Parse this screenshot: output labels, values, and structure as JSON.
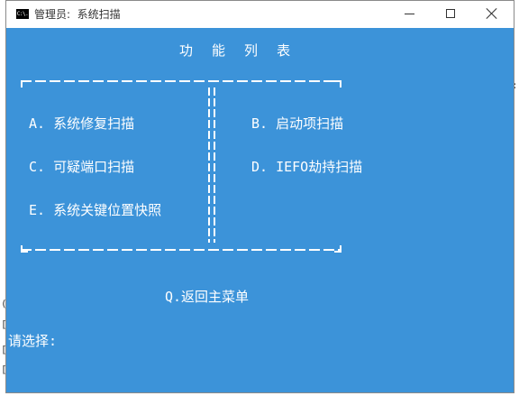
{
  "window": {
    "title": "管理员:  系统扫描",
    "icon": "cmd-icon",
    "icon_text": "C:\\."
  },
  "menu": {
    "heading": "功 能 列 表",
    "options": [
      {
        "key": "A",
        "label": "A. 系统修复扫描"
      },
      {
        "key": "B",
        "label": "B. 启动项扫描"
      },
      {
        "key": "C",
        "label": "C. 可疑端口扫描"
      },
      {
        "key": "D",
        "label": "D. IEFO劫持扫描"
      },
      {
        "key": "E",
        "label": "E. 系统关键位置快照"
      }
    ],
    "back": "Q.返回主菜单"
  },
  "prompt": "请选择:",
  "colors": {
    "console_bg": "#3c93d9",
    "text": "#ffffff",
    "titlebar": "#ffffff"
  }
}
